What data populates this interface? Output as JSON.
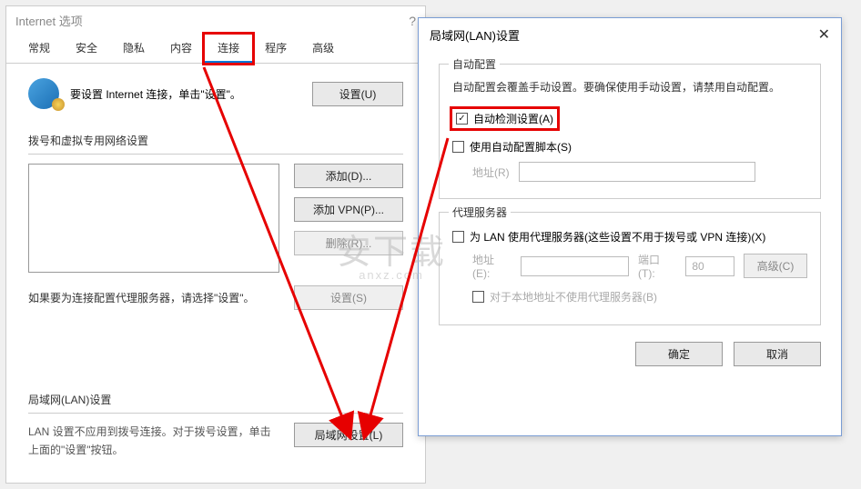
{
  "main": {
    "title": "Internet 选项",
    "help": "?",
    "tabs": [
      "常规",
      "安全",
      "隐私",
      "内容",
      "连接",
      "程序",
      "高级"
    ],
    "active_tab_index": 4,
    "intro_text": "要设置 Internet 连接，单击\"设置\"。",
    "btn_setup": "设置(U)",
    "section1_title": "拨号和虚拟专用网络设置",
    "btn_add": "添加(D)...",
    "btn_addvpn": "添加 VPN(P)...",
    "btn_delete": "删除(R)...",
    "proxy_text": "如果要为连接配置代理服务器，请选择\"设置\"。",
    "btn_settings": "设置(S)",
    "section_lan_title": "局域网(LAN)设置",
    "lan_desc": "LAN 设置不应用到拨号连接。对于拨号设置，单击上面的\"设置\"按钮。",
    "btn_lan": "局域网设置(L)"
  },
  "lan": {
    "title": "局域网(LAN)设置",
    "grp_auto_title": "自动配置",
    "auto_desc": "自动配置会覆盖手动设置。要确保使用手动设置，请禁用自动配置。",
    "cb_auto_detect": "自动检测设置(A)",
    "cb_auto_script": "使用自动配置脚本(S)",
    "addr_label": "地址(R)",
    "grp_proxy_title": "代理服务器",
    "cb_use_proxy": "为 LAN 使用代理服务器(这些设置不用于拨号或 VPN 连接)(X)",
    "addr2_label": "地址(E):",
    "port_label": "端口(T):",
    "port_value": "80",
    "btn_advanced": "高级(C)",
    "cb_bypass": "对于本地地址不使用代理服务器(B)",
    "btn_ok": "确定",
    "btn_cancel": "取消"
  },
  "watermark": {
    "text": "安下载",
    "sub": "anxz.com"
  }
}
